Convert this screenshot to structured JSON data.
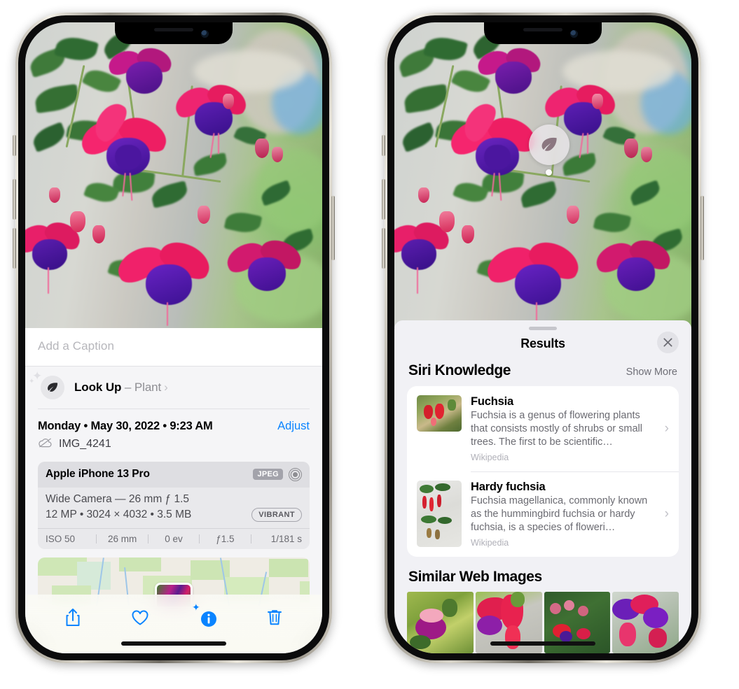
{
  "left_phone": {
    "photo": {
      "alt": "fuchsia-plant-photo"
    },
    "caption_field": {
      "placeholder": "Add a Caption",
      "value": ""
    },
    "look_up": {
      "icon": "leaf-icon",
      "label": "Look Up",
      "dash": " – ",
      "subject": "Plant",
      "chevron": "›"
    },
    "date_row": {
      "date": "Monday • May 30, 2022 • 9:23 AM",
      "adjust_label": "Adjust"
    },
    "file_row": {
      "icon": "icloud-slash-icon",
      "filename": "IMG_4241"
    },
    "camera_card": {
      "model": "Apple iPhone 13 Pro",
      "format_badge": "JPEG",
      "raw_icon": "raw-target-icon",
      "lens_line": "Wide Camera — 26 mm ƒ 1.5",
      "size_line": "12 MP  •  3024 × 4032  •  3.5 MB",
      "style_badge": "VIBRANT",
      "exif": [
        "ISO 50",
        "26 mm",
        "0 ev",
        "ƒ1.5",
        "1/181 s"
      ]
    },
    "map": {
      "pin": "photo-thumbnail-pin"
    },
    "toolbar": [
      {
        "name": "share-icon",
        "label": "Share"
      },
      {
        "name": "heart-icon",
        "label": "Favorite"
      },
      {
        "name": "info-sparkle-icon",
        "label": "Info"
      },
      {
        "name": "trash-icon",
        "label": "Delete"
      }
    ]
  },
  "right_phone": {
    "photo": {
      "alt": "fuchsia-plant-photo"
    },
    "leaf_marker": {
      "icon": "leaf-icon"
    },
    "sheet": {
      "title": "Results",
      "close_label": "✕"
    },
    "siri_knowledge": {
      "heading": "Siri Knowledge",
      "show_more": "Show More",
      "items": [
        {
          "title": "Fuchsia",
          "description": "Fuchsia is a genus of flowering plants that consists mostly of shrubs or small trees. The first to be scientific…",
          "source": "Wikipedia",
          "chevron": "›"
        },
        {
          "title": "Hardy fuchsia",
          "description": "Fuchsia magellanica, commonly known as the hummingbird fuchsia or hardy fuchsia, is a species of floweri…",
          "source": "Wikipedia",
          "chevron": "›"
        }
      ]
    },
    "similar_web_images": {
      "heading": "Similar Web Images",
      "thumbnails": [
        "fuchsia-pink-white-bloom",
        "fuchsia-red-closeup",
        "fuchsia-bush-red-purple",
        "fuchsia-purple-magenta-cluster"
      ]
    }
  },
  "colors": {
    "accent_blue": "#0a84ff",
    "sheet_gray": "#f1f1f5",
    "card_white": "#ffffff",
    "secondary_text": "#6b6b72"
  }
}
